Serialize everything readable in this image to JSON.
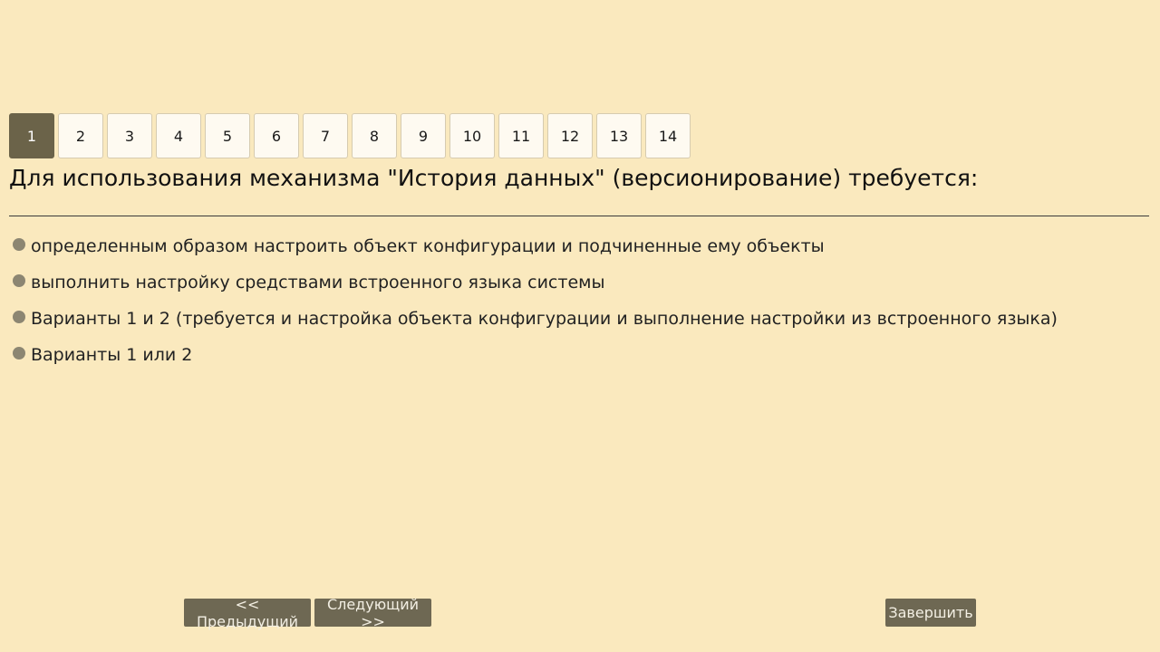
{
  "pager": {
    "active": "1",
    "pages": [
      "1",
      "2",
      "3",
      "4",
      "5",
      "6",
      "7",
      "8",
      "9",
      "10",
      "11",
      "12",
      "13",
      "14"
    ]
  },
  "question": {
    "text": "Для использования механизма \"История данных\" (версионирование) требуется:"
  },
  "answers": [
    "определенным образом настроить объект конфигурации и подчиненные ему объекты",
    "выполнить настройку средствами встроенного языка системы",
    "Варианты 1 и 2 (требуется и настройка объекта конфигурации и выполнение настройки из встроенного языка)",
    "Варианты 1 или 2"
  ],
  "nav": {
    "prev_label": "<< Предыдущий",
    "next_label": "Следующий >>",
    "finish_label": "Завершить"
  },
  "colors": {
    "background": "#fae9be",
    "active_page": "#6b6349",
    "button": "#6e6853",
    "radio": "#8c8672"
  }
}
